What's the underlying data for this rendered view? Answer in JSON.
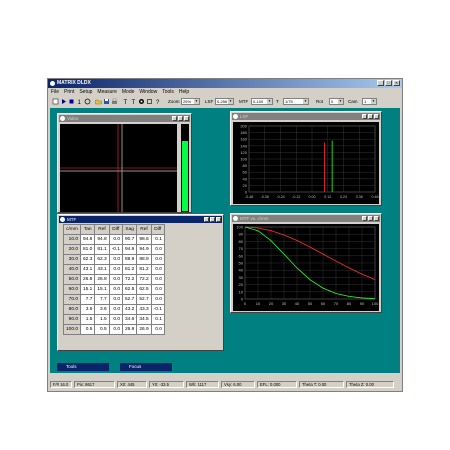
{
  "app": {
    "title": "MATRIX DLDX"
  },
  "menu": [
    "File",
    "Print",
    "Setup",
    "Measure",
    "Mode",
    "Window",
    "Tools",
    "Help"
  ],
  "toolbar": {
    "zoom_label": "Zoom",
    "zoom_value": "25%",
    "lsf_label": "LSF",
    "lsf_value": "0-256",
    "mtf_label": "MTF",
    "mtf_value": "0-100",
    "t_label": "T",
    "t_value": "1/75",
    "rot_label": "Rot",
    "rot_value": "0",
    "cam_label": "Cam",
    "cam_value": "1"
  },
  "windows": {
    "video_title": "Video",
    "lsf_title": "LSF",
    "mtf_title": "MTF",
    "mtf_vs_title": "MTF vs. c/mm",
    "mini1_title": "Tools",
    "mini2_title": "Focus"
  },
  "mtf_table": {
    "headers": [
      "c/mm",
      "Tan",
      "Ref",
      "Diff",
      "Sag",
      "Ref",
      "Diff"
    ],
    "rows": [
      [
        "10.0",
        "94.8",
        "94.8",
        "0.0",
        "90.7",
        "98.6",
        "0.1"
      ],
      [
        "20.0",
        "81.0",
        "81.1",
        "-0.1",
        "94.9",
        "94.9",
        "0.0"
      ],
      [
        "30.0",
        "62.3",
        "62.3",
        "0.0",
        "88.9",
        "88.9",
        "0.0"
      ],
      [
        "40.0",
        "43.1",
        "43.1",
        "0.0",
        "81.2",
        "81.2",
        "0.0"
      ],
      [
        "50.0",
        "26.8",
        "26.8",
        "0.0",
        "72.2",
        "72.2",
        "0.0"
      ],
      [
        "60.0",
        "15.1",
        "15.1",
        "0.0",
        "62.5",
        "62.5",
        "0.0"
      ],
      [
        "70.0",
        "7.7",
        "7.7",
        "0.0",
        "52.7",
        "52.7",
        "0.0"
      ],
      [
        "80.0",
        "3.6",
        "3.6",
        "0.0",
        "43.2",
        "43.3",
        "-0.1"
      ],
      [
        "90.0",
        "1.5",
        "1.5",
        "0.0",
        "34.6",
        "34.5",
        "0.1"
      ],
      [
        "100.0",
        "0.5",
        "0.5",
        "0.0",
        "26.9",
        "26.9",
        "0.0"
      ]
    ]
  },
  "lsf_chart": {
    "y_ticks": [
      "200",
      "180",
      "160",
      "140",
      "120",
      "100",
      "80",
      "60",
      "40",
      "20",
      "0"
    ],
    "x_ticks": [
      "-0.48",
      "-0.36",
      "-0.24",
      "-0.12",
      "0.00",
      "0.12",
      "0.24",
      "0.36",
      "0.48"
    ]
  },
  "chart_data": {
    "type": "line",
    "title": "MTF vs. c/mm",
    "x": [
      0,
      10,
      20,
      30,
      40,
      50,
      60,
      70,
      80,
      90,
      100
    ],
    "xlim": [
      0,
      100
    ],
    "ylim": [
      0,
      100
    ],
    "x_ticks": [
      "0",
      "10",
      "20",
      "30",
      "40",
      "50",
      "60",
      "70",
      "80",
      "90",
      "100"
    ],
    "y_ticks": [
      "100",
      "90",
      "80",
      "70",
      "60",
      "50",
      "40",
      "30",
      "20",
      "10",
      "0"
    ],
    "series": [
      {
        "color": "#ff3030",
        "values": [
          100,
          98.6,
          94.9,
          88.9,
          81.2,
          72.2,
          62.5,
          52.7,
          43.2,
          34.6,
          26.9
        ]
      },
      {
        "color": "#30ff30",
        "values": [
          100,
          94.8,
          81.0,
          62.3,
          43.1,
          26.8,
          15.1,
          7.7,
          3.6,
          1.5,
          0.5
        ]
      }
    ]
  },
  "status": {
    "f_number": "F/# 16.0",
    "pixel": "Pix: 8617",
    "x": "X0: 445",
    "y": "Y0: -33.5",
    "w": "Wh: 1117",
    "v": "Vsy: 6.00",
    "efl": "EFL: 0.000",
    "theta_t": "Theta T: 0.00",
    "theta_z": "Theta Z: 0.00"
  },
  "colors": {
    "mdi_bg": "#008080",
    "title_active": "#0a246a",
    "panel": "#d4d0c8"
  }
}
